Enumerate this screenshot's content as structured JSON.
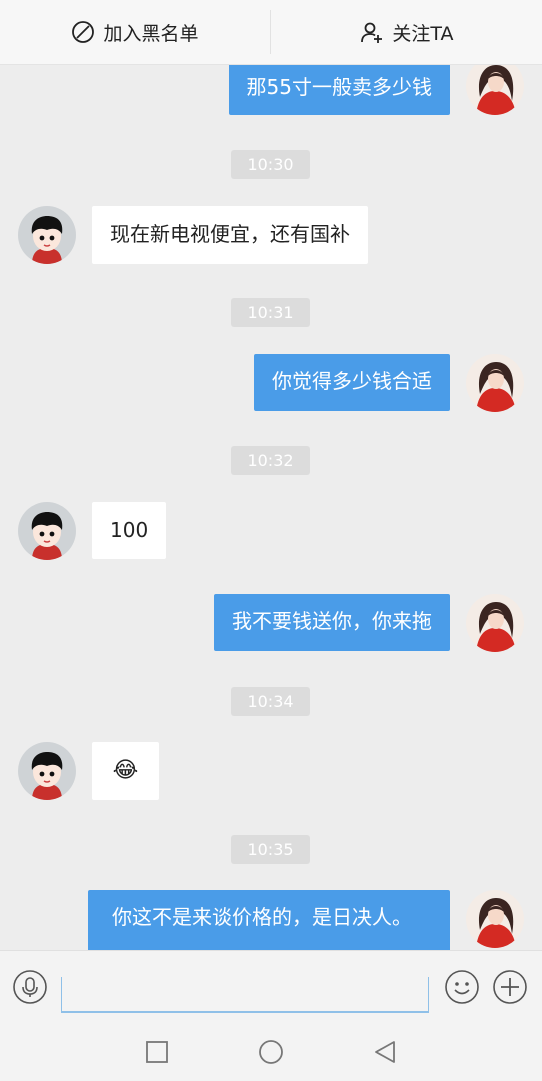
{
  "topbar": {
    "blacklist_label": "加入黑名单",
    "follow_label": "关注TA"
  },
  "messages": [
    {
      "type": "out",
      "text": "那55寸一般卖多少钱"
    },
    {
      "type": "time",
      "text": "10:30"
    },
    {
      "type": "in",
      "text": "现在新电视便宜，还有国补"
    },
    {
      "type": "time",
      "text": "10:31"
    },
    {
      "type": "out",
      "text": "你觉得多少钱合适"
    },
    {
      "type": "time",
      "text": "10:32"
    },
    {
      "type": "in",
      "text": "100"
    },
    {
      "type": "out",
      "text": "我不要钱送你，你来拖"
    },
    {
      "type": "time",
      "text": "10:34"
    },
    {
      "type": "in",
      "emoji": "😂"
    },
    {
      "type": "time",
      "text": "10:35"
    },
    {
      "type": "out",
      "text": "你这不是来谈价格的，是日决人。"
    }
  ],
  "input": {
    "placeholder": ""
  },
  "icons": {
    "voice": "microphone-icon",
    "emoji": "smiley-icon",
    "more": "plus-icon",
    "nav_recent": "square-icon",
    "nav_home": "circle-icon",
    "nav_back": "triangle-back-icon"
  },
  "colors": {
    "outgoing_bubble": "#4a9ce8",
    "incoming_bubble": "#ffffff",
    "background": "#ededed"
  }
}
